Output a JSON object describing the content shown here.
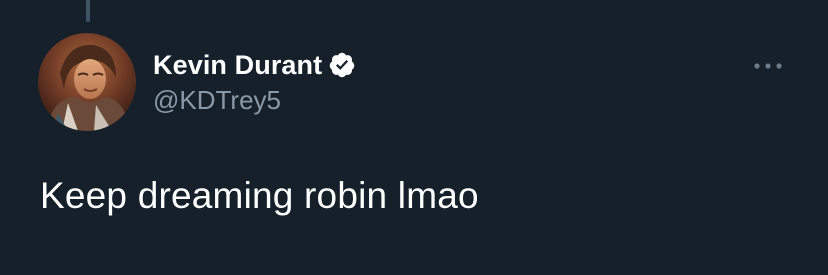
{
  "tweet": {
    "author": {
      "display_name": "Kevin Durant",
      "handle": "@KDTrey5",
      "verified": true,
      "avatar_icon": "avatar-photo-icon"
    },
    "text": "Keep dreaming robin lmao",
    "more_icon": "more-dots-icon"
  },
  "colors": {
    "background": "#15202b",
    "primary_text": "#ffffff",
    "secondary_text": "#8b98a5",
    "thread_line": "#3d5466"
  }
}
